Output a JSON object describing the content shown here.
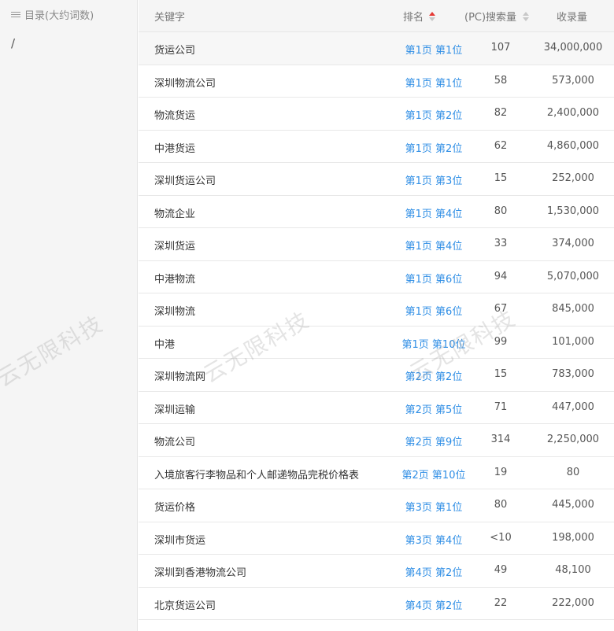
{
  "sidebar": {
    "title": "目录(大约词数)",
    "item": "/"
  },
  "headers": {
    "keyword": "关键字",
    "rank": "排名",
    "pc": "(PC)搜索量",
    "indexed": "收录量"
  },
  "rows": [
    {
      "keyword": "货运公司",
      "rank": "第1页 第1位",
      "pc": "107",
      "indexed": "34,000,000"
    },
    {
      "keyword": "深圳物流公司",
      "rank": "第1页 第1位",
      "pc": "58",
      "indexed": "573,000"
    },
    {
      "keyword": "物流货运",
      "rank": "第1页 第2位",
      "pc": "82",
      "indexed": "2,400,000"
    },
    {
      "keyword": "中港货运",
      "rank": "第1页 第2位",
      "pc": "62",
      "indexed": "4,860,000"
    },
    {
      "keyword": "深圳货运公司",
      "rank": "第1页 第3位",
      "pc": "15",
      "indexed": "252,000"
    },
    {
      "keyword": "物流企业",
      "rank": "第1页 第4位",
      "pc": "80",
      "indexed": "1,530,000"
    },
    {
      "keyword": "深圳货运",
      "rank": "第1页 第4位",
      "pc": "33",
      "indexed": "374,000"
    },
    {
      "keyword": "中港物流",
      "rank": "第1页 第6位",
      "pc": "94",
      "indexed": "5,070,000"
    },
    {
      "keyword": "深圳物流",
      "rank": "第1页 第6位",
      "pc": "67",
      "indexed": "845,000"
    },
    {
      "keyword": "中港",
      "rank": "第1页 第10位",
      "pc": "99",
      "indexed": "101,000"
    },
    {
      "keyword": "深圳物流网",
      "rank": "第2页 第2位",
      "pc": "15",
      "indexed": "783,000"
    },
    {
      "keyword": "深圳运输",
      "rank": "第2页 第5位",
      "pc": "71",
      "indexed": "447,000"
    },
    {
      "keyword": "物流公司",
      "rank": "第2页 第9位",
      "pc": "314",
      "indexed": "2,250,000"
    },
    {
      "keyword": "入境旅客行李物品和个人邮递物品完税价格表",
      "rank": "第2页 第10位",
      "pc": "19",
      "indexed": "80"
    },
    {
      "keyword": "货运价格",
      "rank": "第3页 第1位",
      "pc": "80",
      "indexed": "445,000"
    },
    {
      "keyword": "深圳市货运",
      "rank": "第3页 第4位",
      "pc": "<10",
      "indexed": "198,000"
    },
    {
      "keyword": "深圳到香港物流公司",
      "rank": "第4页 第2位",
      "pc": "49",
      "indexed": "48,100"
    },
    {
      "keyword": "北京货运公司",
      "rank": "第4页 第2位",
      "pc": "22",
      "indexed": "222,000"
    }
  ],
  "watermark": "云无限科技",
  "colors": {
    "link": "#2f8ee5",
    "sort_active": "#e53935"
  }
}
